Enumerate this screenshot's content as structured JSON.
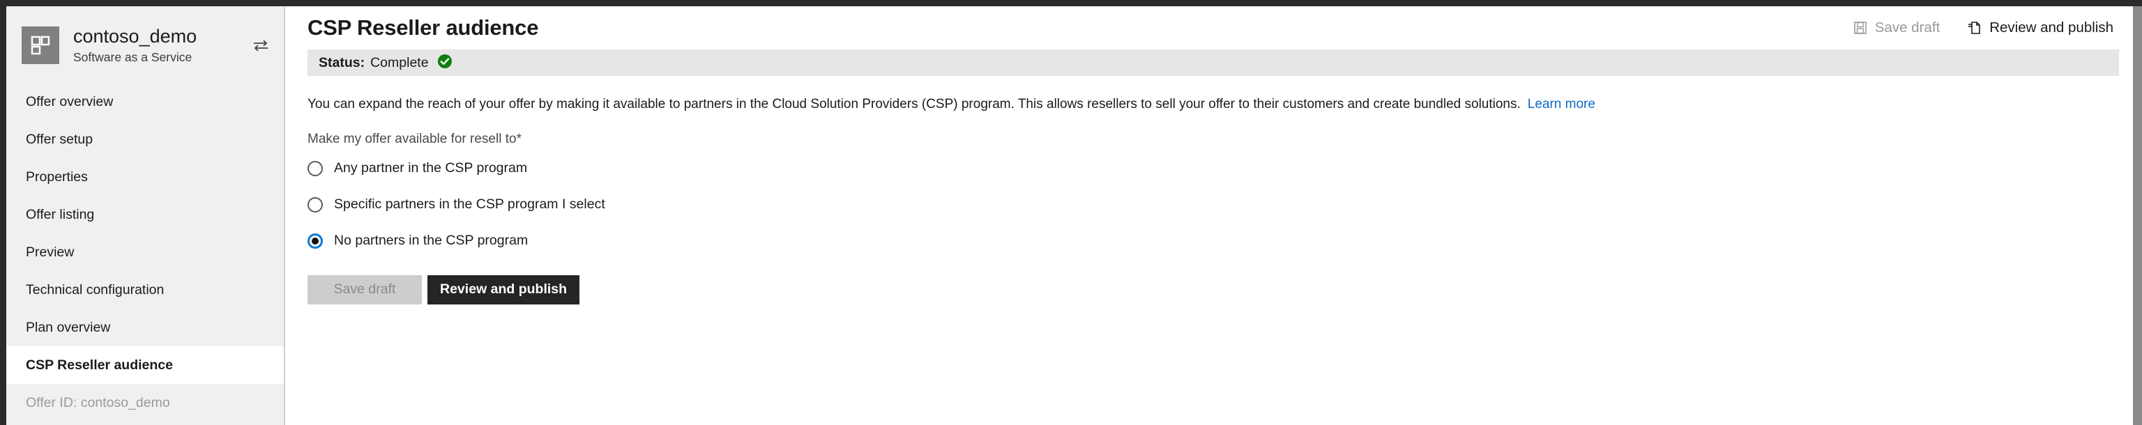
{
  "chrome": {
    "top_bar_color": "#2b2b2b",
    "scrollbar_color": "#8a8a8a"
  },
  "sidebar": {
    "app_name": "contoso_demo",
    "app_subtitle": "Software as a Service",
    "logo_icon": "tile-grid-icon",
    "swap_icon": "swap-arrows-icon",
    "items": [
      {
        "label": "Offer overview",
        "selected": false
      },
      {
        "label": "Offer setup",
        "selected": false
      },
      {
        "label": "Properties",
        "selected": false
      },
      {
        "label": "Offer listing",
        "selected": false
      },
      {
        "label": "Preview",
        "selected": false
      },
      {
        "label": "Technical configuration",
        "selected": false
      },
      {
        "label": "Plan overview",
        "selected": false
      },
      {
        "label": "CSP Reseller audience",
        "selected": true
      }
    ],
    "footer": "Offer ID: contoso_demo"
  },
  "header": {
    "title": "CSP Reseller audience",
    "save_draft_label": "Save draft",
    "save_draft_icon": "save-floppy-icon",
    "save_draft_disabled": true,
    "review_publish_label": "Review and publish",
    "review_publish_icon": "publish-page-icon"
  },
  "status": {
    "label": "Status:",
    "value": "Complete",
    "icon": "green-check-circle-icon",
    "icon_color": "#107C10"
  },
  "main": {
    "description": "You can expand the reach of your offer by making it available to partners in the Cloud Solution Providers (CSP) program. This allows resellers to sell your offer to their customers and create bundled solutions.",
    "learn_more_label": "Learn more",
    "field_label": "Make my offer available for resell to",
    "required_marker": "*",
    "radio_options": [
      {
        "label": "Any partner in the CSP program",
        "checked": false
      },
      {
        "label": "Specific partners in the CSP program I select",
        "checked": false
      },
      {
        "label": "No partners in the CSP program",
        "checked": true
      }
    ],
    "save_draft_label": "Save draft",
    "save_draft_disabled": true,
    "review_publish_label": "Review and publish"
  },
  "colors": {
    "accent_blue": "#0d7ad4",
    "link_blue": "#0d6cc4",
    "success_green": "#107C10",
    "sidebar_bg": "#f0f0f0",
    "status_bg": "#e6e6e6",
    "primary_btn_bg": "#252525"
  }
}
